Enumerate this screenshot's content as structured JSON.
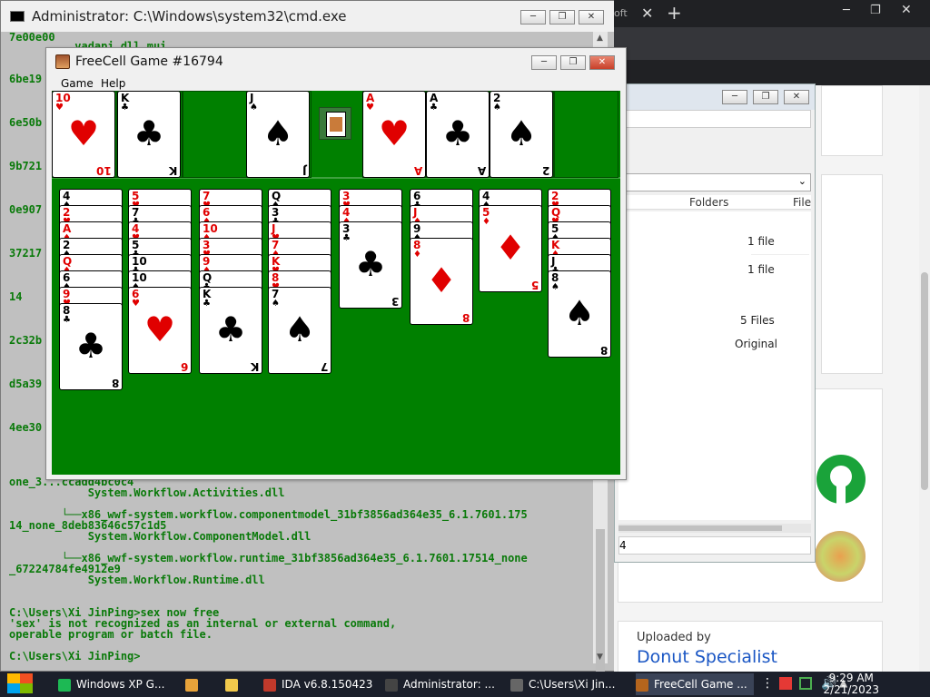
{
  "cmd": {
    "title": "Administrator: C:\\Windows\\system32\\cmd.exe",
    "left_fragments": [
      "7e00e00",
      "6be19",
      "6e50b",
      "9b721",
      "0e907",
      "37217",
      "14",
      "2c32b",
      "d5a39",
      "4ee30"
    ],
    "lines": [
      {
        "text": "          vadapi.dll.mui"
      },
      {
        "text": "one_3...ccadd4bc0c4"
      },
      {
        "text": "            System.Workflow.Activities.dll"
      },
      {
        "text": "        └──x86_wwf-system.workflow.componentmodel_31bf3856ad364e35_6.1.7601.175"
      },
      {
        "text": "14_none_8deb83646c57c1d5"
      },
      {
        "text": "            System.Workflow.ComponentModel.dll"
      },
      {
        "text": "        └──x86_wwf-system.workflow.runtime_31bf3856ad364e35_6.1.7601.17514_none"
      },
      {
        "text": "_67224784fe4912e9"
      },
      {
        "text": "            System.Workflow.Runtime.dll"
      },
      {
        "text": "C:\\Users\\Xi JinPing>sex now free"
      },
      {
        "text": "'sex' is not recognized as an internal or external command,"
      },
      {
        "text": "operable program or batch file."
      },
      {
        "text": "C:\\Users\\Xi JinPing>"
      }
    ]
  },
  "browser": {
    "tab_fragment": "oft",
    "explorer_cols": [
      "Folders",
      "File"
    ],
    "explorer_items": [
      "1 file",
      "1 file",
      "5 Files",
      "Original"
    ],
    "explorer_status": "4",
    "uploaded_by": "Uploaded by",
    "uploader": "Donut Specialist",
    "badge_count": "5"
  },
  "freecell": {
    "title": "FreeCell Game #16794",
    "menu": [
      "Game",
      "Help"
    ],
    "free_cells": [
      {
        "rank": "10",
        "suit": "♥",
        "color": "red"
      },
      {
        "rank": "K",
        "suit": "♣",
        "color": "blk"
      },
      null,
      {
        "rank": "J",
        "suit": "♠",
        "color": "blk"
      }
    ],
    "foundations": [
      {
        "rank": "A",
        "suit": "♥",
        "color": "red"
      },
      {
        "rank": "A",
        "suit": "♣",
        "color": "blk"
      },
      {
        "rank": "2",
        "suit": "♠",
        "color": "blk"
      },
      null
    ],
    "columns": [
      [
        [
          "4",
          "♠",
          "blk"
        ],
        [
          "2",
          "♥",
          "red"
        ],
        [
          "A",
          "♦",
          "red"
        ],
        [
          "2",
          "♠",
          "blk"
        ],
        [
          "Q",
          "♦",
          "red"
        ],
        [
          "6",
          "♠",
          "blk"
        ],
        [
          "9",
          "♥",
          "red"
        ],
        [
          "8",
          "♣",
          "blk"
        ]
      ],
      [
        [
          "5",
          "♥",
          "red"
        ],
        [
          "7",
          "♣",
          "blk"
        ],
        [
          "4",
          "♥",
          "red"
        ],
        [
          "5",
          "♣",
          "blk"
        ],
        [
          "10",
          "♣",
          "blk"
        ],
        [
          "10",
          "♠",
          "blk"
        ],
        [
          "6",
          "♥",
          "red"
        ]
      ],
      [
        [
          "7",
          "♥",
          "red"
        ],
        [
          "6",
          "♦",
          "red"
        ],
        [
          "10",
          "♦",
          "red"
        ],
        [
          "3",
          "♥",
          "red"
        ],
        [
          "9",
          "♦",
          "red"
        ],
        [
          "Q",
          "♣",
          "blk"
        ],
        [
          "K",
          "♣",
          "blk"
        ]
      ],
      [
        [
          "Q",
          "♠",
          "blk"
        ],
        [
          "3",
          "♣",
          "blk"
        ],
        [
          "J",
          "♥",
          "red"
        ],
        [
          "7",
          "♦",
          "red"
        ],
        [
          "K",
          "♥",
          "red"
        ],
        [
          "8",
          "♥",
          "red"
        ],
        [
          "7",
          "♠",
          "blk"
        ]
      ],
      [
        [
          "3",
          "♥",
          "red"
        ],
        [
          "4",
          "♦",
          "red"
        ],
        [
          "3",
          "♣",
          "blk"
        ]
      ],
      [
        [
          "6",
          "♣",
          "blk"
        ],
        [
          "J",
          "♦",
          "red"
        ],
        [
          "9",
          "♠",
          "blk"
        ],
        [
          "8",
          "♦",
          "red"
        ]
      ],
      [
        [
          "4",
          "♠",
          "blk"
        ],
        [
          "5",
          "♦",
          "red"
        ]
      ],
      [
        [
          "2",
          "♥",
          "red"
        ],
        [
          "Q",
          "♥",
          "red"
        ],
        [
          "5",
          "♠",
          "blk"
        ],
        [
          "K",
          "♦",
          "red"
        ],
        [
          "J",
          "♣",
          "blk"
        ],
        [
          "8",
          "♠",
          "blk"
        ]
      ]
    ]
  },
  "taskbar": {
    "items": [
      {
        "label": "Windows XP G...",
        "color": "#1db954"
      },
      {
        "label": "",
        "color": "#e8a33a"
      },
      {
        "label": "",
        "color": "#f2c94c"
      },
      {
        "label": "IDA v6.8.150423",
        "color": "#c0392b"
      },
      {
        "label": "Administrator: ...",
        "color": "#444"
      },
      {
        "label": "C:\\Users\\Xi Jin...",
        "color": "#666"
      },
      {
        "label": "FreeCell Game ...",
        "color": "#b5651d"
      }
    ],
    "time": "9:29 AM",
    "date": "2/21/2023"
  }
}
